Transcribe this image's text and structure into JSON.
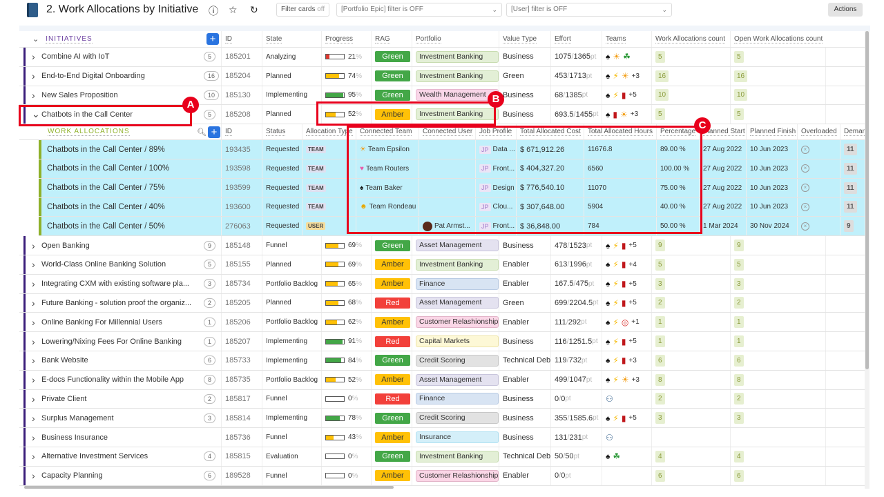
{
  "header": {
    "title": "2. Work Allocations by Initiative",
    "filter_cards_label": "Filter cards",
    "filter_cards_state": "off",
    "portfolio_filter": "[Portfolio Epic] filter is OFF",
    "user_filter": "[User] filter is OFF",
    "actions_label": "Actions"
  },
  "colors": {
    "accent": "#2a74e0",
    "Green": "#43a747",
    "Amber": "#ffc107",
    "Red": "#f2403a",
    "initiative_marker": "#3a1d7a",
    "allocation_marker": "#8fb12a",
    "allocation_row_bg": "#c0f0fb",
    "annotation": "#e8001c"
  },
  "portfolio_colors": {
    "Investment Banking": [
      "#e3efd6",
      "#c7dcb0"
    ],
    "Wealth Management": [
      "#f9d6e8",
      "#e6b7cf"
    ],
    "Asset Management": [
      "#e4e2f0",
      "#c8c5dc"
    ],
    "Finance": [
      "#d8e4f3",
      "#b9cbe4"
    ],
    "Customer Relashionships": [
      "#fad6e6",
      "#e3b5c9"
    ],
    "Capital Markets": [
      "#fdf8d6",
      "#eee4a8"
    ],
    "Credit Scoring": [
      "#e2e2e2",
      "#c8c8c8"
    ],
    "Insurance": [
      "#d4eff9",
      "#ade0f2"
    ]
  },
  "initiatives_header": {
    "section": "INITIATIVES",
    "cols": [
      "ID",
      "State",
      "Progress",
      "RAG",
      "Portfolio",
      "Value Type",
      "Effort",
      "Teams",
      "Work Allocations count",
      "Open Work Allocations count"
    ]
  },
  "initiatives": [
    {
      "name": "Combine AI with IoT",
      "count": "5",
      "id": "185201",
      "state": "Analyzing",
      "progress": 21,
      "rag": "Green",
      "portfolio": "Investment Banking",
      "value_type": "Business",
      "effort_done": "1075",
      "effort_total": "1365",
      "unit": "pt",
      "teams": [
        "spade",
        "sun",
        "clover"
      ],
      "teams_more": "",
      "wa_count": "5",
      "open_wa_count": "5"
    },
    {
      "name": "End-to-End Digital Onboarding",
      "count": "16",
      "id": "185204",
      "state": "Planned",
      "progress": 74,
      "rag": "Green",
      "portfolio": "Investment Banking",
      "value_type": "Green",
      "effort_done": "453",
      "effort_total": "1713",
      "unit": "pt",
      "teams": [
        "spade",
        "bolt",
        "sun"
      ],
      "teams_more": "+3",
      "wa_count": "16",
      "open_wa_count": "16"
    },
    {
      "name": "New Sales Proposition",
      "count": "10",
      "id": "185130",
      "state": "Implementing",
      "progress": 95,
      "rag": "Green",
      "portfolio": "Wealth Management",
      "value_type": "Business",
      "effort_done": "68",
      "effort_total": "1385",
      "unit": "pt",
      "teams": [
        "spade",
        "bolt",
        "book"
      ],
      "teams_more": "+5",
      "wa_count": "10",
      "open_wa_count": "10"
    },
    {
      "name": "Chatbots in the Call Center",
      "count": "5",
      "id": "185208",
      "state": "Planned",
      "progress": 52,
      "rag": "Amber",
      "portfolio": "Investment Banking",
      "value_type": "Business",
      "effort_done": "693.5",
      "effort_total": "1455",
      "unit": "pt",
      "teams": [
        "spade",
        "book",
        "sun"
      ],
      "teams_more": "+3",
      "wa_count": "5",
      "open_wa_count": "5",
      "expanded": true
    },
    {
      "name": "Open Banking",
      "count": "9",
      "id": "185148",
      "state": "Funnel",
      "progress": 69,
      "rag": "Green",
      "portfolio": "Asset Management",
      "value_type": "Business",
      "effort_done": "478",
      "effort_total": "1523",
      "unit": "pt",
      "teams": [
        "spade",
        "bolt",
        "book"
      ],
      "teams_more": "+5",
      "wa_count": "9",
      "open_wa_count": "9"
    },
    {
      "name": "World-Class Online Banking Solution",
      "count": "5",
      "id": "185155",
      "state": "Planned",
      "progress": 69,
      "rag": "Amber",
      "portfolio": "Investment Banking",
      "value_type": "Enabler",
      "effort_done": "613",
      "effort_total": "1996",
      "unit": "pt",
      "teams": [
        "spade",
        "bolt",
        "book"
      ],
      "teams_more": "+4",
      "wa_count": "5",
      "open_wa_count": "5"
    },
    {
      "name": "Integrating CXM with existing software pla...",
      "count": "3",
      "id": "185734",
      "state": "Portfolio Backlog",
      "progress": 65,
      "rag": "Amber",
      "portfolio": "Finance",
      "value_type": "Enabler",
      "effort_done": "167.5",
      "effort_total": "475",
      "unit": "pt",
      "teams": [
        "spade",
        "bolt",
        "book"
      ],
      "teams_more": "+5",
      "wa_count": "3",
      "open_wa_count": "3"
    },
    {
      "name": "Future Banking - solution proof the organiz...",
      "count": "2",
      "id": "185205",
      "state": "Planned",
      "progress": 68,
      "rag": "Red",
      "portfolio": "Asset Management",
      "value_type": "Green",
      "effort_done": "699",
      "effort_total": "2204.5",
      "unit": "pt",
      "teams": [
        "spade",
        "bolt",
        "book"
      ],
      "teams_more": "+5",
      "wa_count": "2",
      "open_wa_count": "2"
    },
    {
      "name": "Online Banking For Millennial Users",
      "count": "1",
      "id": "185206",
      "state": "Portfolio Backlog",
      "progress": 62,
      "rag": "Amber",
      "portfolio": "Customer Relashionships",
      "value_type": "Enabler",
      "effort_done": "111",
      "effort_total": "292",
      "unit": "pt",
      "teams": [
        "spade",
        "bolt",
        "target"
      ],
      "teams_more": "+1",
      "wa_count": "1",
      "open_wa_count": "1"
    },
    {
      "name": "Lowering/Nixing Fees For Online Banking",
      "count": "1",
      "id": "185207",
      "state": "Implementing",
      "progress": 91,
      "rag": "Red",
      "portfolio": "Capital Markets",
      "value_type": "Business",
      "effort_done": "116",
      "effort_total": "1251.5",
      "unit": "pt",
      "teams": [
        "spade",
        "bolt",
        "book"
      ],
      "teams_more": "+5",
      "wa_count": "1",
      "open_wa_count": "1"
    },
    {
      "name": "Bank Website",
      "count": "6",
      "id": "185733",
      "state": "Implementing",
      "progress": 84,
      "rag": "Green",
      "portfolio": "Credit Scoring",
      "value_type": "Technical Debt",
      "effort_done": "119",
      "effort_total": "732",
      "unit": "pt",
      "teams": [
        "spade",
        "bolt",
        "book"
      ],
      "teams_more": "+3",
      "wa_count": "6",
      "open_wa_count": "6"
    },
    {
      "name": "E-docs Functionality within the Mobile App",
      "count": "8",
      "id": "185735",
      "state": "Portfolio Backlog",
      "progress": 52,
      "rag": "Amber",
      "portfolio": "Asset Management",
      "value_type": "Enabler",
      "effort_done": "499",
      "effort_total": "1047",
      "unit": "pt",
      "teams": [
        "spade",
        "bolt",
        "sun"
      ],
      "teams_more": "+3",
      "wa_count": "8",
      "open_wa_count": "8"
    },
    {
      "name": "Private Client",
      "count": "2",
      "id": "185817",
      "state": "Funnel",
      "progress": 0,
      "rag": "Red",
      "portfolio": "Finance",
      "value_type": "Business",
      "effort_done": "0",
      "effort_total": "0",
      "unit": "pt",
      "teams": [
        "users"
      ],
      "teams_more": "",
      "wa_count": "2",
      "open_wa_count": "2"
    },
    {
      "name": "Surplus Management",
      "count": "3",
      "id": "185814",
      "state": "Implementing",
      "progress": 78,
      "rag": "Green",
      "portfolio": "Credit Scoring",
      "value_type": "Business",
      "effort_done": "355",
      "effort_total": "1585.6",
      "unit": "pt",
      "teams": [
        "spade",
        "bolt",
        "book"
      ],
      "teams_more": "+5",
      "wa_count": "3",
      "open_wa_count": "3"
    },
    {
      "name": "Business Insurance",
      "count": "",
      "id": "185736",
      "state": "Funnel",
      "progress": 43,
      "rag": "Amber",
      "portfolio": "Insurance",
      "value_type": "Business",
      "effort_done": "131",
      "effort_total": "231",
      "unit": "pt",
      "teams": [
        "users"
      ],
      "teams_more": "",
      "wa_count": "",
      "open_wa_count": ""
    },
    {
      "name": "Alternative Investment Services",
      "count": "4",
      "id": "185815",
      "state": "Evaluation",
      "progress": 0,
      "rag": "Green",
      "portfolio": "Investment Banking",
      "value_type": "Technical Debt",
      "effort_done": "50",
      "effort_total": "50",
      "unit": "pt",
      "teams": [
        "spade",
        "clover"
      ],
      "teams_more": "",
      "wa_count": "4",
      "open_wa_count": "4"
    },
    {
      "name": "Capacity Planning",
      "count": "6",
      "id": "189528",
      "state": "Funnel",
      "progress": 0,
      "rag": "Amber",
      "portfolio": "Customer Relashionships",
      "value_type": "Enabler",
      "effort_done": "0",
      "effort_total": "0",
      "unit": "pt",
      "teams": [],
      "teams_more": "",
      "wa_count": "6",
      "open_wa_count": "6"
    }
  ],
  "allocations_header": {
    "section": "WORK ALLOCATIONS",
    "cols": [
      "ID",
      "Status",
      "Allocation Type",
      "Connected Team",
      "Connected User",
      "Job Profile",
      "Total Allocated Cost",
      "Total Allocated Hours",
      "Percentage",
      "Planned Start",
      "Planned Finish",
      "Overloaded",
      "Deman"
    ]
  },
  "allocations": [
    {
      "name": "Chatbots in the Call Center / 89%",
      "id": "193435",
      "status": "Requested",
      "type": "TEAM",
      "team_icon": "sun",
      "team": "Team Epsilon",
      "user": "",
      "job_badge": "JP",
      "job": "Data ...",
      "cost": "$ 671,912.26",
      "hours": "11676.8",
      "percentage": "89.00 %",
      "start": "27 Aug 2022",
      "finish": "10 Jun 2023",
      "demand": "11"
    },
    {
      "name": "Chatbots in the Call Center / 100%",
      "id": "193598",
      "status": "Requested",
      "type": "TEAM",
      "team_icon": "heart",
      "team": "Team Routers",
      "user": "",
      "job_badge": "JP",
      "job": "Front...",
      "cost": "$ 404,327.20",
      "hours": "6560",
      "percentage": "100.00 %",
      "start": "27 Aug 2022",
      "finish": "10 Jun 2023",
      "demand": "11"
    },
    {
      "name": "Chatbots in the Call Center / 75%",
      "id": "193599",
      "status": "Requested",
      "type": "TEAM",
      "team_icon": "spade",
      "team": "Team Baker",
      "user": "",
      "job_badge": "JP",
      "job": "Design",
      "cost": "$ 776,540.10",
      "hours": "11070",
      "percentage": "75.00 %",
      "start": "27 Aug 2022",
      "finish": "10 Jun 2023",
      "demand": "11"
    },
    {
      "name": "Chatbots in the Call Center / 40%",
      "id": "193600",
      "status": "Requested",
      "type": "TEAM",
      "team_icon": "sunglasses",
      "team": "Team Rondeau",
      "user": "",
      "job_badge": "JP",
      "job": "Clou...",
      "cost": "$ 307,648.00",
      "hours": "5904",
      "percentage": "40.00 %",
      "start": "27 Aug 2022",
      "finish": "10 Jun 2023",
      "demand": "11"
    },
    {
      "name": "Chatbots in the Call Center / 50%",
      "id": "276063",
      "status": "Requested",
      "type": "USER",
      "team_icon": "",
      "team": "",
      "user": "Pat Armst...",
      "job_badge": "JP",
      "job": "Front...",
      "cost": "$ 36,848.00",
      "hours": "784",
      "percentage": "50.00 %",
      "start": "1 Mar 2024",
      "finish": "30 Nov 2024",
      "demand": "9"
    }
  ],
  "annotations": [
    "A",
    "B",
    "C"
  ]
}
